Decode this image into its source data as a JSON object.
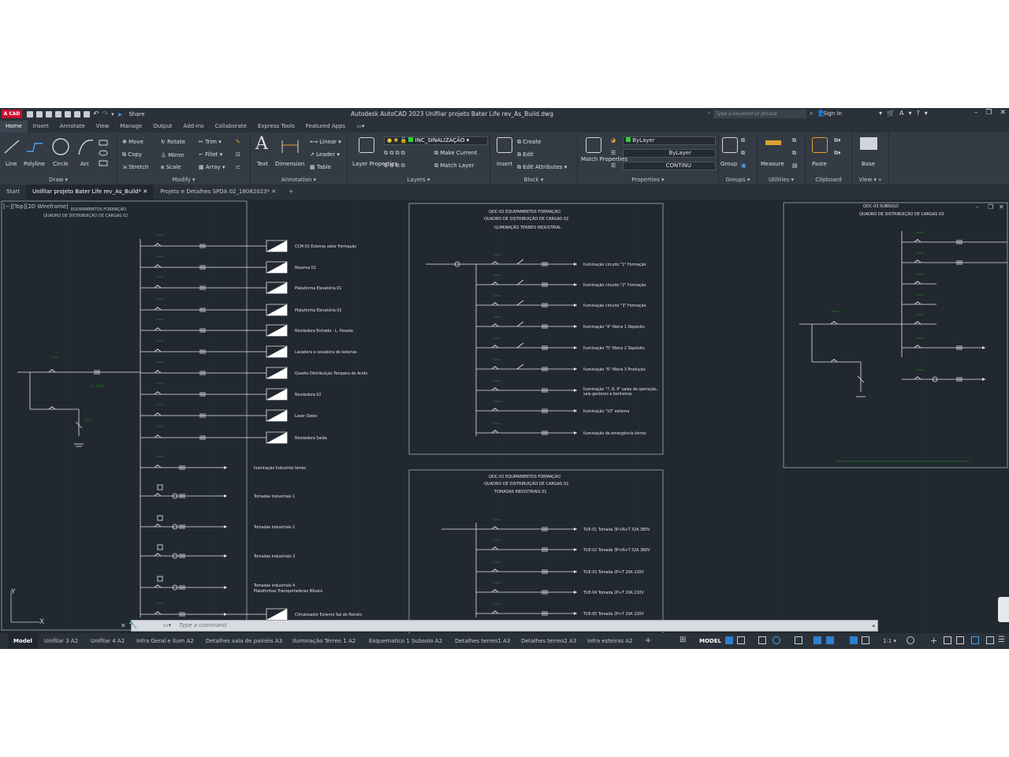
{
  "title_bar": {
    "logo": "A CAD",
    "share": "Share",
    "title": "Autodesk AutoCAD 2023   Unifilar projeto Bater Life rev_As_Build.dwg",
    "search_placeholder": "Type a keyword or phrase",
    "sign_in": "Sign In"
  },
  "menu_tabs": [
    "Home",
    "Insert",
    "Annotate",
    "View",
    "Manage",
    "Output",
    "Add-ins",
    "Collaborate",
    "Express Tools",
    "Featured Apps"
  ],
  "ribbon": {
    "draw": {
      "label": "Draw",
      "line": "Line",
      "polyline": "Polyline",
      "circle": "Circle",
      "arc": "Arc"
    },
    "modify": {
      "label": "Modify",
      "move": "Move",
      "rotate": "Rotate",
      "trim": "Trim",
      "copy": "Copy",
      "mirror": "Mirror",
      "fillet": "Fillet",
      "stretch": "Stretch",
      "scale": "Scale",
      "array": "Array"
    },
    "annotation": {
      "label": "Annotation",
      "text": "Text",
      "dimension": "Dimension",
      "linear": "Linear",
      "leader": "Leader",
      "table": "Table"
    },
    "layers": {
      "label": "Layers",
      "layer_properties": "Layer Properties",
      "current_layer": "INC_SINALIZAÇÃO",
      "make_current": "Make Current",
      "match_layer": "Match Layer"
    },
    "block": {
      "label": "Block",
      "insert": "Insert",
      "create": "Create",
      "edit": "Edit",
      "edit_attributes": "Edit Attributes"
    },
    "properties": {
      "label": "Properties",
      "match_properties": "Match Properties",
      "color": "ByLayer",
      "lineweight": "ByLayer",
      "linetype": "CONTINU"
    },
    "groups": {
      "label": "Groups",
      "group": "Group"
    },
    "utilities": {
      "label": "Utilities",
      "measure": "Measure"
    },
    "clipboard": {
      "label": "Clipboard",
      "paste": "Paste"
    },
    "view": {
      "label": "View",
      "base": "Base"
    }
  },
  "doc_tabs": [
    "Start",
    "Unifilar projeto Bater Life rev_As_Build*",
    "Projeto e Detalhes SPDA 02_18082023*"
  ],
  "viewport_label": "[−][Top][2D Wireframe]",
  "drawing": {
    "left_panel": {
      "header1": "EQUIPAMENTOS FORMAÇÃO",
      "header2": "QUADRO DE DISTRIBUIÇÃO DE CARGAS 02",
      "loads": [
        "CCM-01 Esteiras setor Formação",
        "Reserva 01",
        "Plataforma Elevatória 01",
        "Plataforma Elevatória 02",
        "Niveladora Entrada - L. Pesada",
        "Lavadora e secadora de baterias",
        "Quadro Distribuição Tempera de Acido",
        "Niveladora 02",
        "Laser Datec",
        "Niveladora Saída"
      ],
      "loads2": [
        "Iluminação Industrial térreo",
        "Tomadas industriais 1",
        "Tomadas industriais 2",
        "Tomadas industriais 3",
        "Tomadas industriais 4 Plataformas Transportadoras Móveis",
        "Climatizador Externo Sal de Painéis"
      ]
    },
    "mid_panel_1": {
      "code": "QDC-02",
      "header1": "EQUIPAMENTOS FORMAÇÃO",
      "header2": "QUADRO DE DISTRIBUIÇÃO DE CARGAS 02",
      "header3": "ILUMINAÇÃO TERREO INDUSTRIAL",
      "circuits": [
        "Iluminação circuito \"1\" Formação",
        "Iluminação circuito \"2\" Formação",
        "Iluminação circuito \"3\" Formação",
        "Iluminação \"4\" fileira 1 Depósito",
        "Iluminação \"5\" fileira 2 Depósito",
        "Iluminação \"6\" fileira 3 Produção",
        "Iluminação \"7, 8, 9\" salas de operação, sala gestores e banheiros",
        "Iluminação \"10\" externa",
        "Iluminação de emergência térreo"
      ]
    },
    "mid_panel_2": {
      "code": "QDC-02",
      "header1": "EQUIPAMENTOS FORMAÇÃO",
      "header2": "QUADRO DE DISTRIBUIÇÃO DE CARGAS 02",
      "header3": "TOMADAS INDUSTRIAIS 01",
      "circuits": [
        "TUE-01 Tomada 3P+N+T 32A 380V",
        "TUE-02 Tomada 3P+N+T 32A 380V",
        "TUE-03 Tomada 2P+T 20A 220V",
        "TUE-04 Tomada 2P+T 20A 220V",
        "TUE-05 Tomada 2P+T 20A 220V"
      ]
    },
    "right_panel": {
      "code": "QDC-03",
      "header1": "SUBSOLO",
      "header2": "QUADRO DE DISTRIBUIÇÃO DE CARGAS 03"
    }
  },
  "command_line": {
    "placeholder": "Type a command"
  },
  "status_bar": {
    "layouts": [
      "Model",
      "Unifilar 3 A2",
      "Unifilar 4 A2",
      "Infra Geral e Ilum A2",
      "Detalhes sala de painéis A3",
      "Iluminação Térreo 1 A2",
      "Esquematico 1 Subsolo A2",
      "Detalhes terreo1 A3",
      "Detalhes terreo2 A3",
      "Infra esteiras A2"
    ],
    "model": "MODEL",
    "scale": "1:1"
  },
  "colors": {
    "canvas": "#212830",
    "ribbon": "#343b45",
    "accent": "#2f7fd0",
    "wire": "#e6e6e6",
    "annotation_green": "#1f7a1f"
  }
}
